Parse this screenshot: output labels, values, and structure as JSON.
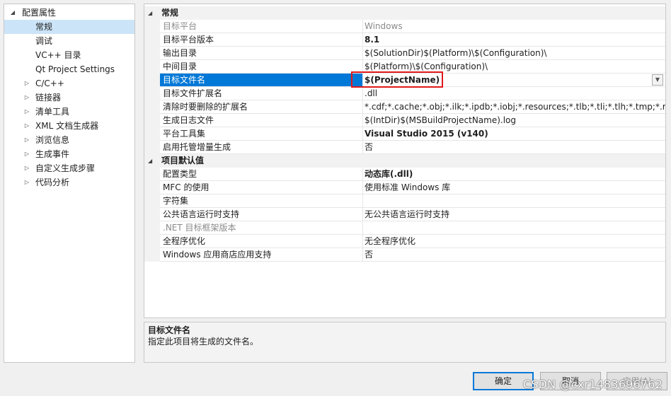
{
  "tree": {
    "root": {
      "label": "配置属性",
      "expanded": true
    },
    "items": [
      {
        "label": "常规",
        "selected": true,
        "expandable": false
      },
      {
        "label": "调试",
        "expandable": false
      },
      {
        "label": "VC++ 目录",
        "expandable": false
      },
      {
        "label": "Qt Project Settings",
        "expandable": false
      },
      {
        "label": "C/C++",
        "expandable": true
      },
      {
        "label": "链接器",
        "expandable": true
      },
      {
        "label": "清单工具",
        "expandable": true
      },
      {
        "label": "XML 文档生成器",
        "expandable": true
      },
      {
        "label": "浏览信息",
        "expandable": true
      },
      {
        "label": "生成事件",
        "expandable": true
      },
      {
        "label": "自定义生成步骤",
        "expandable": true
      },
      {
        "label": "代码分析",
        "expandable": true
      }
    ]
  },
  "grid": {
    "categories": [
      {
        "label": "常规",
        "rows": [
          {
            "name": "目标平台",
            "value": "Windows",
            "disabled": true
          },
          {
            "name": "目标平台版本",
            "value": "8.1",
            "bold": true
          },
          {
            "name": "输出目录",
            "value": "$(SolutionDir)$(Platform)\\$(Configuration)\\"
          },
          {
            "name": "中间目录",
            "value": "$(Platform)\\$(Configuration)\\"
          },
          {
            "name": "目标文件名",
            "value": "$(ProjectName)",
            "selected": true
          },
          {
            "name": "目标文件扩展名",
            "value": ".dll"
          },
          {
            "name": "清除时要删除的扩展名",
            "value": "*.cdf;*.cache;*.obj;*.ilk;*.ipdb;*.iobj;*.resources;*.tlb;*.tli;*.tlh;*.tmp;*.rsp;*.pg"
          },
          {
            "name": "生成日志文件",
            "value": "$(IntDir)$(MSBuildProjectName).log"
          },
          {
            "name": "平台工具集",
            "value": "Visual Studio 2015 (v140)",
            "bold": true
          },
          {
            "name": "启用托管增量生成",
            "value": "否"
          }
        ]
      },
      {
        "label": "项目默认值",
        "rows": [
          {
            "name": "配置类型",
            "value": "动态库(.dll)",
            "bold": true
          },
          {
            "name": "MFC 的使用",
            "value": "使用标准 Windows 库"
          },
          {
            "name": "字符集",
            "value": ""
          },
          {
            "name": "公共语言运行时支持",
            "value": "无公共语言运行时支持"
          },
          {
            "name": ".NET 目标框架版本",
            "value": "",
            "disabled": true
          },
          {
            "name": "全程序优化",
            "value": "无全程序优化"
          },
          {
            "name": "Windows 应用商店应用支持",
            "value": "否"
          }
        ]
      }
    ]
  },
  "description": {
    "title": "目标文件名",
    "text": "指定此项目将生成的文件名。"
  },
  "buttons": {
    "ok": "确定",
    "cancel": "取消",
    "apply": "应用(A)"
  },
  "watermark": "CSDN @cxr1483696762",
  "colors": {
    "selection": "#0078d7",
    "tree_selection": "#cce4f7",
    "highlight_box": "#e0191b"
  }
}
